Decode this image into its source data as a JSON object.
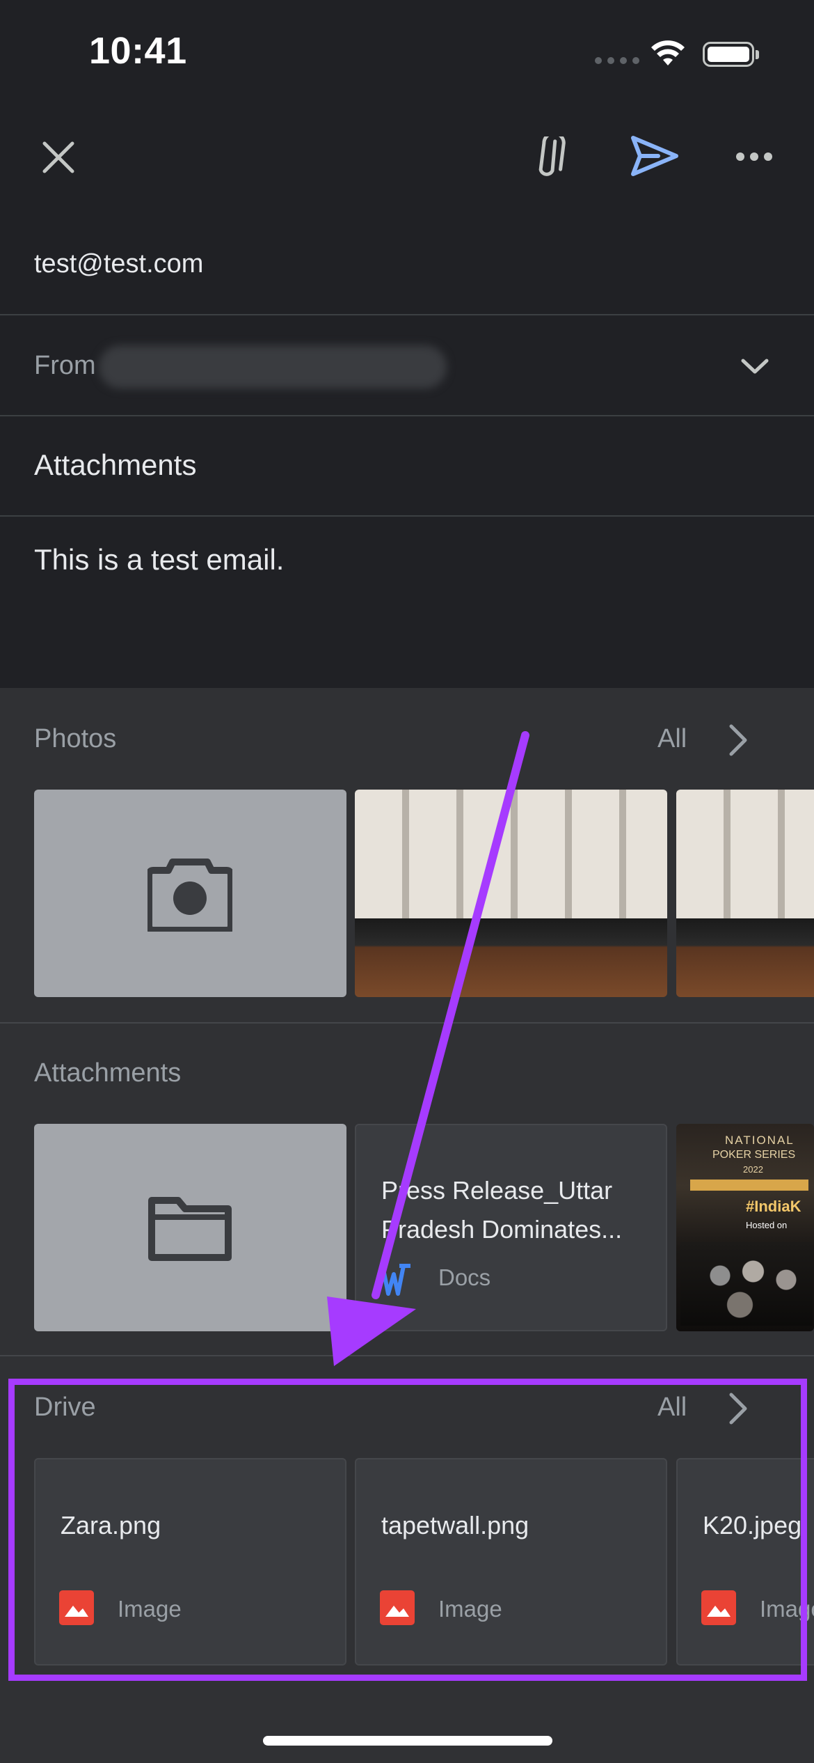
{
  "status_bar": {
    "time": "10:41"
  },
  "compose": {
    "to": "test@test.com",
    "from_label": "From",
    "subject": "Attachments",
    "body": "This is a test email."
  },
  "sheet": {
    "photos": {
      "title": "Photos",
      "all_label": "All"
    },
    "attachments": {
      "title": "Attachments",
      "doc": {
        "name": "Press Release_Uttar Pradesh Dominates...",
        "type": "Docs"
      },
      "poster_text": {
        "line1": "NATIONAL",
        "line2": "POKER SERIES",
        "line3": "2022",
        "tag": "#IndiaK",
        "hosted": "Hosted on"
      }
    },
    "drive": {
      "title": "Drive",
      "all_label": "All",
      "files": [
        {
          "name": "Zara.png",
          "type": "Image"
        },
        {
          "name": "tapetwall.png",
          "type": "Image"
        },
        {
          "name": "K20.jpeg",
          "type": "Image"
        }
      ]
    }
  },
  "colors": {
    "background": "#202125",
    "sheet": "#303134",
    "send_accent": "#8ab4f8",
    "annotation": "#a63bff",
    "image_icon": "#ea4335"
  }
}
